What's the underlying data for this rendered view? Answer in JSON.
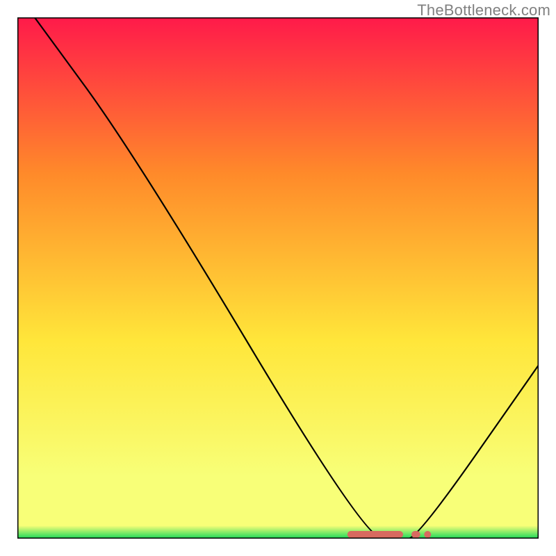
{
  "watermark": "TheBottleneck.com",
  "colors": {
    "gradient_top": "#ff1a4a",
    "gradient_mid1": "#ff8a2a",
    "gradient_mid2": "#ffe63a",
    "gradient_mid3": "#f8ff78",
    "gradient_bottom": "#19d85a",
    "curve_stroke": "#000000",
    "marker_fill": "#d86a60",
    "frame_stroke": "#000000"
  },
  "chart_data": {
    "type": "line",
    "title": "",
    "xlabel": "",
    "ylabel": "",
    "xlim": [
      0,
      100
    ],
    "ylim": [
      0,
      100
    ],
    "grid": false,
    "legend": false,
    "x": [
      3.3,
      22.7,
      66.7,
      73.3,
      76.7,
      100
    ],
    "series": [
      {
        "name": "bottleneck-curve",
        "values": [
          100,
          73.5,
          0,
          0,
          0,
          33.3
        ]
      }
    ],
    "markers": {
      "name": "optimal-band",
      "segments": [
        {
          "x0": 63.3,
          "x1": 74.0,
          "y": 0
        },
        {
          "x0": 75.6,
          "x1": 77.3,
          "y": 0
        }
      ],
      "isolated_points": [
        {
          "x": 78.7,
          "y": 0
        }
      ]
    }
  }
}
